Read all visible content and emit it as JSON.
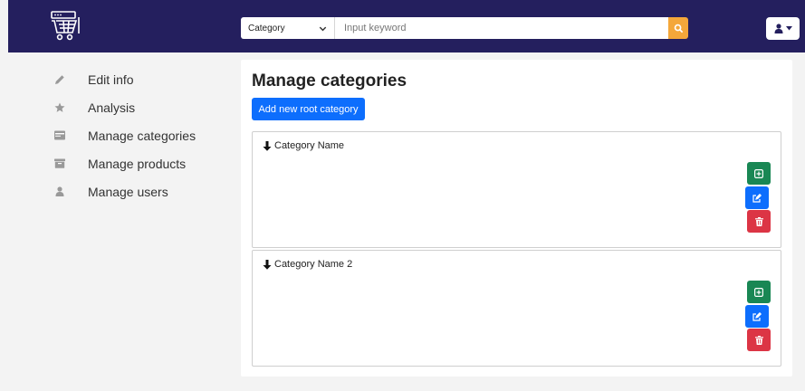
{
  "header": {
    "search": {
      "category_label": "Category",
      "keyword_placeholder": "Input keyword"
    }
  },
  "sidebar": {
    "items": [
      {
        "label": "Edit info",
        "icon": "pencil-icon"
      },
      {
        "label": "Analysis",
        "icon": "star-icon"
      },
      {
        "label": "Manage categories",
        "icon": "card-icon"
      },
      {
        "label": "Manage products",
        "icon": "archive-icon"
      },
      {
        "label": "Manage users",
        "icon": "user-icon"
      }
    ]
  },
  "main": {
    "title": "Manage categories",
    "add_root_label": "Add new root category",
    "categories": [
      {
        "name": "Category Name"
      },
      {
        "name": "Category Name 2"
      }
    ]
  },
  "colors": {
    "navbar": "#241f5e",
    "accent_orange": "#f4a73a",
    "primary": "#0d6efd",
    "success": "#198754",
    "danger": "#dc3545"
  }
}
